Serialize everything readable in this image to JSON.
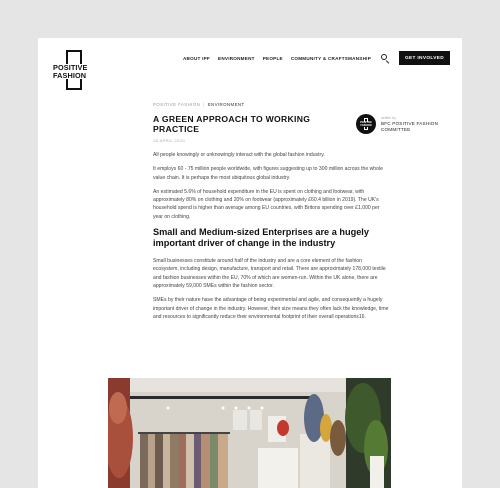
{
  "logo": {
    "line1": "POSITIVE",
    "line2": "FASHION"
  },
  "nav": {
    "items": [
      "ABOUT IPF",
      "ENVIRONMENT",
      "PEOPLE",
      "COMMUNITY & CRAFTSMANSHIP"
    ],
    "search_icon": "search-icon",
    "cta_label": "GET INVOLVED"
  },
  "breadcrumb": {
    "parent": "POSITIVE FASHION",
    "separator": "|",
    "current": "ENVIRONMENT"
  },
  "article": {
    "title": "A GREEN APPROACH TO WORKING PRACTICE",
    "date": "18 APRIL 2020",
    "author": {
      "by": "written by",
      "name": "BFC POSITIVE FASHION COMMITTEE",
      "avatar_text": "POSITIVE FASHION"
    },
    "paragraphs": [
      "All people knowingly or unknowingly interact with the global fashion industry.",
      "It employs 60 - 75 million people worldwide, with figures suggesting up to 300 million across the whole value chain. It is perhaps the most ubiquitous global industry.",
      "An estimated 5.6% of household expenditure in the EU is spent on clothing and footwear, with approximately 80% on clothing and 20% on footwear (approximately £60.4 billion in 2019). The UK's household spend is higher than average among EU countries, with Britons spending over £1,000 per year on clothing."
    ],
    "subheading": "Small and Medium-sized Enterprises are a hugely important driver of change in the industry",
    "paragraphs2": [
      "Small businesses constitute around half of the industry and are a core element of the fashion ecosystem, including design, manufacture, transport and retail. There are approximately 178,000 textile and fashion businesses within the EU, 70% of which are women-run. Within the UK alone, there are approximately 59,000 SMEs within the fashion sector.",
      "SMEs by their nature have the advantage of being experimental and agile, and consequently a hugely important driver of change in the industry. However, their size means they often lack the knowledge, time and resources to significantly reduce their environmental footprint of their overall operations16."
    ]
  },
  "colors": {
    "background": "#e5e5e5",
    "page": "#ffffff",
    "brand": "#111111",
    "muted": "#999999"
  }
}
